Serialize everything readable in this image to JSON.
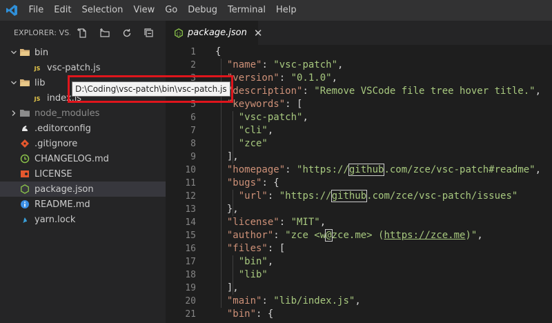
{
  "menu": [
    "File",
    "Edit",
    "Selection",
    "View",
    "Go",
    "Debug",
    "Terminal",
    "Help"
  ],
  "explorer": {
    "title": "EXPLORER: VS...",
    "actions": [
      "new-file-icon",
      "new-folder-icon",
      "refresh-icon",
      "collapse-all-icon"
    ]
  },
  "tree": [
    {
      "label": "bin",
      "kind": "folder-open",
      "indent": 0,
      "twistie": "open"
    },
    {
      "label": "vsc-patch.js",
      "kind": "js",
      "indent": 1
    },
    {
      "label": "lib",
      "kind": "folder-open",
      "indent": 0,
      "twistie": "open"
    },
    {
      "label": "index.js",
      "kind": "js",
      "indent": 1
    },
    {
      "label": "node_modules",
      "kind": "folder",
      "indent": 0,
      "twistie": "closed",
      "dim": true
    },
    {
      "label": ".editorconfig",
      "kind": "editorconfig",
      "indent": 0
    },
    {
      "label": ".gitignore",
      "kind": "git",
      "indent": 0
    },
    {
      "label": "CHANGELOG.md",
      "kind": "changelog",
      "indent": 0
    },
    {
      "label": "LICENSE",
      "kind": "license",
      "indent": 0
    },
    {
      "label": "package.json",
      "kind": "npm",
      "indent": 0,
      "selected": true
    },
    {
      "label": "README.md",
      "kind": "readme",
      "indent": 0
    },
    {
      "label": "yarn.lock",
      "kind": "yarn",
      "indent": 0
    }
  ],
  "tooltip": "D:\\Coding\\vsc-patch\\bin\\vsc-patch.js",
  "tab": {
    "label": "package.json",
    "close": "✕"
  },
  "lines": [
    {
      "n": "1",
      "t": [
        [
          "pun",
          "{"
        ]
      ]
    },
    {
      "n": "2",
      "t": [
        [
          "pun",
          "  "
        ],
        [
          "key",
          "\"name\""
        ],
        [
          "pun",
          ": "
        ],
        [
          "str",
          "\"vsc-patch\""
        ],
        [
          "pun",
          ","
        ]
      ]
    },
    {
      "n": "3",
      "t": [
        [
          "pun",
          "  "
        ],
        [
          "key",
          "\"version\""
        ],
        [
          "pun",
          ": "
        ],
        [
          "str",
          "\"0.1.0\""
        ],
        [
          "pun",
          ","
        ]
      ]
    },
    {
      "n": "4",
      "t": [
        [
          "pun",
          "  "
        ],
        [
          "key",
          "\"description\""
        ],
        [
          "pun",
          ": "
        ],
        [
          "str",
          "\"Remove VSCode file tree hover title.\""
        ],
        [
          "pun",
          ","
        ]
      ]
    },
    {
      "n": "5",
      "t": [
        [
          "pun",
          "  "
        ],
        [
          "key",
          "\"keywords\""
        ],
        [
          "pun",
          ": ["
        ]
      ]
    },
    {
      "n": "6",
      "t": [
        [
          "pun",
          "    "
        ],
        [
          "str",
          "\"vsc-patch\""
        ],
        [
          "pun",
          ","
        ]
      ]
    },
    {
      "n": "7",
      "t": [
        [
          "pun",
          "    "
        ],
        [
          "str",
          "\"cli\""
        ],
        [
          "pun",
          ","
        ]
      ]
    },
    {
      "n": "8",
      "t": [
        [
          "pun",
          "    "
        ],
        [
          "str",
          "\"zce\""
        ]
      ]
    },
    {
      "n": "9",
      "t": [
        [
          "pun",
          "  ],"
        ]
      ]
    },
    {
      "n": "10",
      "t": [
        [
          "pun",
          "  "
        ],
        [
          "key",
          "\"homepage\""
        ],
        [
          "pun",
          ": "
        ],
        [
          "str",
          "\"https://"
        ],
        [
          "strbox",
          "github"
        ],
        [
          "str",
          ".com/zce/vsc-patch#readme\""
        ],
        [
          "pun",
          ","
        ]
      ]
    },
    {
      "n": "11",
      "t": [
        [
          "pun",
          "  "
        ],
        [
          "key",
          "\"bugs\""
        ],
        [
          "pun",
          ": {"
        ]
      ]
    },
    {
      "n": "12",
      "t": [
        [
          "pun",
          "    "
        ],
        [
          "key",
          "\"url\""
        ],
        [
          "pun",
          ": "
        ],
        [
          "str",
          "\"https://"
        ],
        [
          "strbox",
          "github"
        ],
        [
          "str",
          ".com/zce/vsc-patch/issues\""
        ]
      ]
    },
    {
      "n": "13",
      "t": [
        [
          "pun",
          "  },"
        ]
      ]
    },
    {
      "n": "14",
      "t": [
        [
          "pun",
          "  "
        ],
        [
          "key",
          "\"license\""
        ],
        [
          "pun",
          ": "
        ],
        [
          "str",
          "\"MIT\""
        ],
        [
          "pun",
          ","
        ]
      ]
    },
    {
      "n": "15",
      "t": [
        [
          "pun",
          "  "
        ],
        [
          "key",
          "\"author\""
        ],
        [
          "pun",
          ": "
        ],
        [
          "str",
          "\"zce <w"
        ],
        [
          "strbox",
          "@"
        ],
        [
          "str",
          "zce.me> ("
        ],
        [
          "strul",
          "https://zce.me"
        ],
        [
          "str",
          ")\""
        ],
        [
          "pun",
          ","
        ]
      ]
    },
    {
      "n": "16",
      "t": [
        [
          "pun",
          "  "
        ],
        [
          "key",
          "\"files\""
        ],
        [
          "pun",
          ": ["
        ]
      ]
    },
    {
      "n": "17",
      "t": [
        [
          "pun",
          "    "
        ],
        [
          "str",
          "\"bin\""
        ],
        [
          "pun",
          ","
        ]
      ]
    },
    {
      "n": "18",
      "t": [
        [
          "pun",
          "    "
        ],
        [
          "str",
          "\"lib\""
        ]
      ]
    },
    {
      "n": "19",
      "t": [
        [
          "pun",
          "  ],"
        ]
      ]
    },
    {
      "n": "20",
      "t": [
        [
          "pun",
          "  "
        ],
        [
          "key",
          "\"main\""
        ],
        [
          "pun",
          ": "
        ],
        [
          "str",
          "\"lib/index.js\""
        ],
        [
          "pun",
          ","
        ]
      ]
    },
    {
      "n": "21",
      "t": [
        [
          "pun",
          "  "
        ],
        [
          "key",
          "\"bin\""
        ],
        [
          "pun",
          ": {"
        ]
      ]
    }
  ],
  "colors": {
    "accent_blue": "#0078d4",
    "highlight_red": "#e0151c",
    "json_key": "#ce9178",
    "json_string": "#a8c97f"
  }
}
